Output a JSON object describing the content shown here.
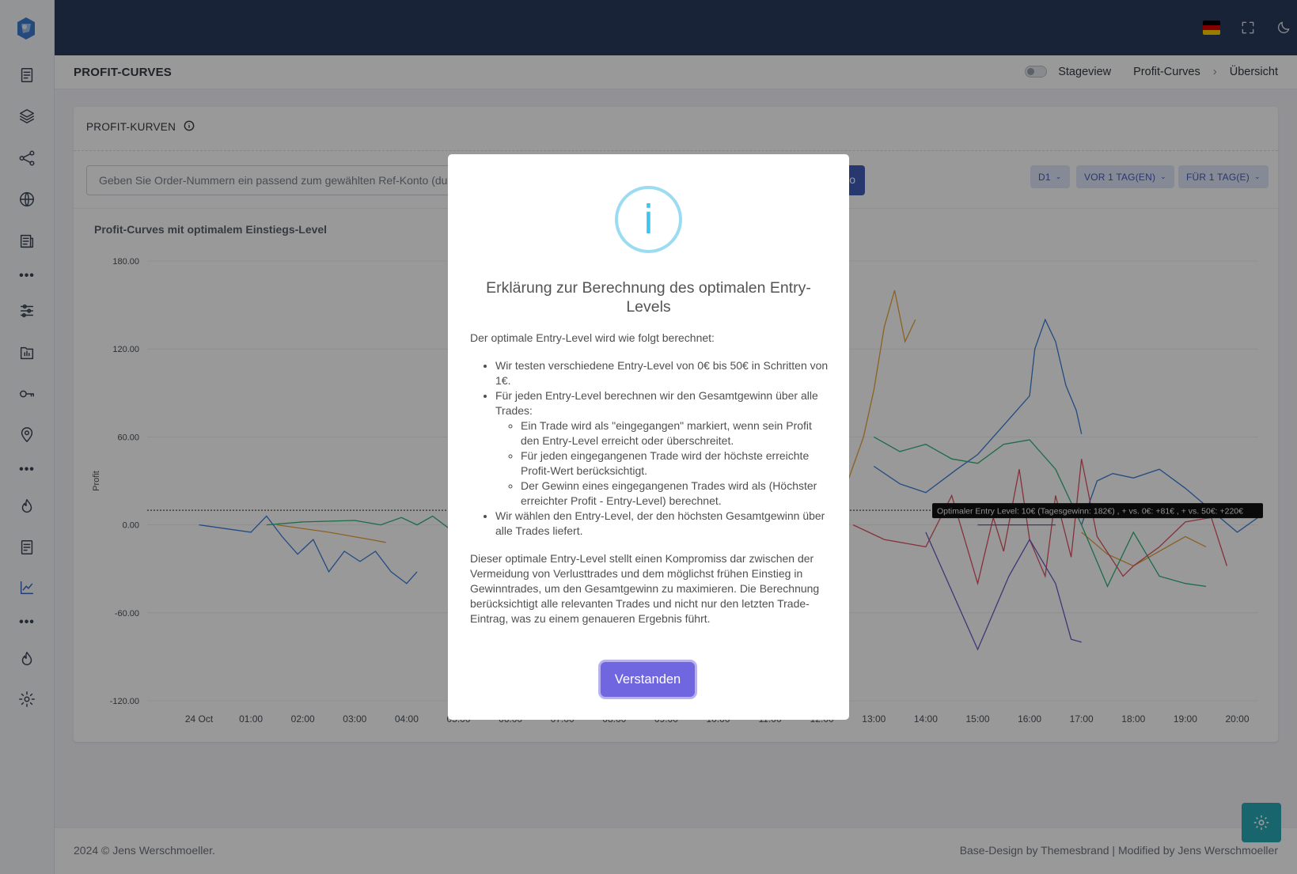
{
  "sidebar": {
    "items": [
      "dashboard-icon",
      "layers-icon",
      "share-nodes-icon",
      "globe-icon",
      "newspaper-icon",
      "more-icon",
      "sliders-icon",
      "folder-chart-icon",
      "key-icon",
      "location-pin-icon",
      "more-icon",
      "fire-icon",
      "report-icon",
      "chart-line-icon",
      "more-icon",
      "fire-icon",
      "gear-icon"
    ],
    "more": "•••"
  },
  "topbar": {
    "icons": [
      "flag-de",
      "fullscreen-icon",
      "moon-icon",
      "bell-icon"
    ],
    "flag_colors": [
      "#000000",
      "#dd0000",
      "#ffce00"
    ]
  },
  "page": {
    "title": "PROFIT-CURVES",
    "stageview_label": "Stageview",
    "breadcrumb": [
      "Profit-Curves",
      "Übersicht"
    ]
  },
  "card": {
    "title": "PROFIT-KURVEN",
    "input_placeholder": "Geben Sie Order-Nummern ein passend zum gewählten Ref-Konto (dur",
    "go_label": "o",
    "filters": [
      "D1",
      "VOR 1 TAG(EN)",
      "FÜR 1 TAG(E)"
    ]
  },
  "chart_data": {
    "type": "line",
    "title": "Profit-Curves mit optimalem Einstiegs-Level",
    "ylabel": "Profit",
    "xlabel": "",
    "ylim": [
      -120,
      180
    ],
    "yticks": [
      "180.00",
      "120.00",
      "60.00",
      "0.00",
      "-60.00",
      "-120.00"
    ],
    "xticks": [
      "24 Oct",
      "01:00",
      "02:00",
      "03:00",
      "04:00",
      "05:00",
      "06:00",
      "07:00",
      "08:00",
      "09:00",
      "10:00",
      "11:00",
      "12:00",
      "13:00",
      "14:00",
      "15:00",
      "16:00",
      "17:00",
      "18:00",
      "19:00",
      "20:00"
    ],
    "optimal_entry_level": 10,
    "annotation": "Optimaler Entry Level: 10€ (Tagesgewinn: 182€) , + vs. 0€: +81€ , + vs. 50€: +220€",
    "series": [
      {
        "color": "#3b7dd8",
        "points": [
          [
            0,
            0
          ],
          [
            1,
            -5
          ],
          [
            1.3,
            6
          ],
          [
            1.6,
            -8
          ],
          [
            1.9,
            -20
          ],
          [
            2.2,
            -10
          ],
          [
            2.5,
            -32
          ],
          [
            2.8,
            -18
          ],
          [
            3.1,
            -25
          ],
          [
            3.4,
            -18
          ],
          [
            3.7,
            -32
          ],
          [
            4.0,
            -40
          ],
          [
            4.2,
            -32
          ]
        ]
      },
      {
        "color": "#3b7dd8",
        "points": [
          [
            13.0,
            40
          ],
          [
            13.5,
            28
          ],
          [
            14.0,
            22
          ],
          [
            14.6,
            38
          ],
          [
            15.0,
            48
          ],
          [
            15.3,
            60
          ],
          [
            15.6,
            72
          ],
          [
            16.0,
            88
          ],
          [
            16.1,
            120
          ],
          [
            16.3,
            140
          ],
          [
            16.5,
            125
          ],
          [
            16.7,
            95
          ],
          [
            16.9,
            78
          ],
          [
            17.0,
            62
          ]
        ]
      },
      {
        "color": "#3b7dd8",
        "points": [
          [
            17.0,
            0
          ],
          [
            17.3,
            30
          ],
          [
            17.6,
            35
          ],
          [
            18.0,
            32
          ],
          [
            18.5,
            38
          ],
          [
            19.0,
            25
          ],
          [
            19.5,
            10
          ],
          [
            20.0,
            -5
          ],
          [
            20.4,
            5
          ]
        ]
      },
      {
        "color": "#e8a33a",
        "points": [
          [
            1.5,
            0
          ],
          [
            2.5,
            -5
          ],
          [
            3.3,
            -10
          ],
          [
            3.6,
            -12
          ]
        ]
      },
      {
        "color": "#e8a33a",
        "points": [
          [
            12.5,
            30
          ],
          [
            12.8,
            60
          ],
          [
            13.0,
            92
          ],
          [
            13.2,
            135
          ],
          [
            13.4,
            160
          ],
          [
            13.6,
            125
          ],
          [
            13.8,
            140
          ]
        ]
      },
      {
        "color": "#e8a33a",
        "points": [
          [
            17.0,
            -5
          ],
          [
            17.5,
            -20
          ],
          [
            18.0,
            -28
          ],
          [
            19.0,
            -8
          ],
          [
            19.4,
            -15
          ]
        ]
      },
      {
        "color": "#2fb37a",
        "points": [
          [
            1.3,
            0
          ],
          [
            2.0,
            2
          ],
          [
            3.0,
            3
          ],
          [
            3.5,
            0
          ],
          [
            3.9,
            5
          ],
          [
            4.2,
            0
          ],
          [
            4.5,
            6
          ],
          [
            4.8,
            -2
          ]
        ]
      },
      {
        "color": "#2fb37a",
        "points": [
          [
            13.0,
            60
          ],
          [
            13.5,
            50
          ],
          [
            14.0,
            55
          ],
          [
            14.5,
            45
          ],
          [
            15.0,
            42
          ],
          [
            15.5,
            55
          ],
          [
            16.0,
            58
          ],
          [
            16.5,
            38
          ],
          [
            17.0,
            0
          ],
          [
            17.5,
            -42
          ],
          [
            18.0,
            -5
          ],
          [
            18.5,
            -35
          ],
          [
            19.0,
            -40
          ],
          [
            19.4,
            -42
          ]
        ]
      },
      {
        "color": "#e05262",
        "points": [
          [
            12.6,
            0
          ],
          [
            13.2,
            -10
          ],
          [
            14.0,
            -15
          ],
          [
            14.5,
            20
          ],
          [
            15.0,
            -40
          ],
          [
            15.3,
            5
          ],
          [
            15.5,
            -18
          ],
          [
            15.8,
            38
          ],
          [
            16.0,
            -10
          ],
          [
            16.3,
            -35
          ],
          [
            16.5,
            20
          ],
          [
            16.8,
            -22
          ],
          [
            17.0,
            45
          ],
          [
            17.3,
            -8
          ],
          [
            17.8,
            -35
          ],
          [
            18.0,
            -28
          ],
          [
            18.5,
            -15
          ],
          [
            19.0,
            2
          ],
          [
            19.5,
            5
          ],
          [
            19.8,
            -28
          ]
        ]
      },
      {
        "color": "#6a5bc4",
        "points": [
          [
            14.0,
            -5
          ],
          [
            15.0,
            -85
          ],
          [
            15.6,
            -35
          ],
          [
            16.0,
            -10
          ],
          [
            16.5,
            -40
          ],
          [
            16.8,
            -78
          ],
          [
            17.0,
            -80
          ]
        ]
      },
      {
        "color": "#6a5bc4",
        "points": [
          [
            15.0,
            0
          ],
          [
            16.0,
            0
          ],
          [
            16.5,
            0
          ]
        ]
      }
    ]
  },
  "modal": {
    "title": "Erklärung zur Berechnung des optimalen Entry-Levels",
    "intro": "Der optimale Entry-Level wird wie folgt berechnet:",
    "bullets": [
      "Wir testen verschiedene Entry-Level von 0€ bis 50€ in Schritten von 1€.",
      "Für jeden Entry-Level berechnen wir den Gesamtgewinn über alle Trades:",
      "Wir wählen den Entry-Level, der den höchsten Gesamtgewinn über alle Trades liefert."
    ],
    "sub_bullets": [
      "Ein Trade wird als \"eingegangen\" markiert, wenn sein Profit den Entry-Level erreicht oder überschreitet.",
      "Für jeden eingegangenen Trade wird der höchste erreichte Profit-Wert berücksichtigt.",
      "Der Gewinn eines eingegangenen Trades wird als (Höchster erreichter Profit - Entry-Level) berechnet."
    ],
    "conclusion": "Dieser optimale Entry-Level stellt einen Kompromiss dar zwischen der Vermeidung von Verlusttrades und dem möglichst frühen Einstieg in Gewinntrades, um den Gesamtgewinn zu maximieren. Die Berechnung berücksichtigt alle relevanten Trades und nicht nur den letzten Trade-Eintrag, was zu einem genaueren Ergebnis führt.",
    "confirm_label": "Verstanden"
  },
  "footer": {
    "left": "2024 © Jens Werschmoeller.",
    "right": "Base-Design by Themesbrand | Modified by Jens Werschmoeller"
  }
}
